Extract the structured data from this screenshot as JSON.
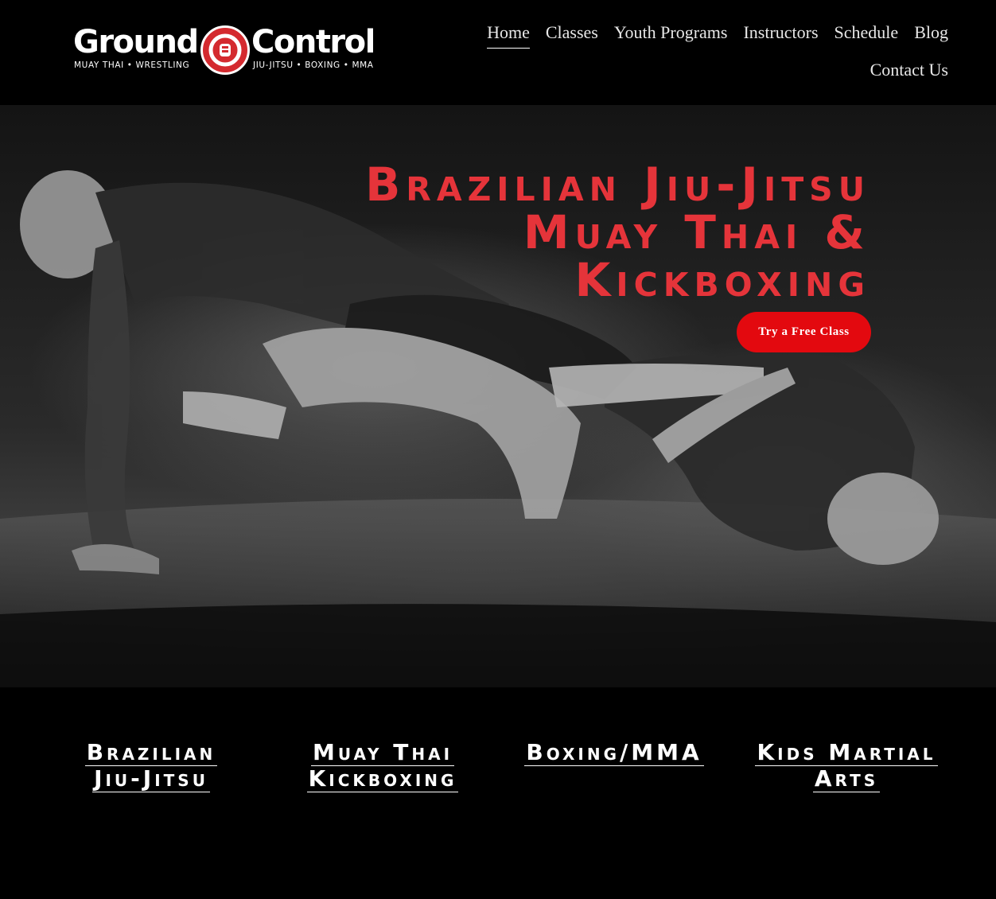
{
  "brand": {
    "name_left": "Ground",
    "name_right": "Control",
    "tagline_left": "MUAY THAI • WRESTLING",
    "tagline_right": "JIU-JITSU • BOXING • MMA",
    "emblem_icon": "fist-emblem-icon",
    "accent_color": "#e5343a"
  },
  "nav": {
    "items": [
      {
        "label": "Home",
        "active": true
      },
      {
        "label": "Classes"
      },
      {
        "label": "Youth Programs"
      },
      {
        "label": "Instructors"
      },
      {
        "label": "Schedule"
      },
      {
        "label": "Blog"
      },
      {
        "label": "Contact Us"
      }
    ]
  },
  "hero": {
    "title_lines": [
      "Brazilian Jiu-Jitsu",
      "Muay Thai &",
      "Kickboxing"
    ],
    "cta_label": "Try a Free Class",
    "cta_color": "#e3090f"
  },
  "programs": [
    {
      "lines": [
        "Brazilian",
        "Jiu-Jitsu"
      ]
    },
    {
      "lines": [
        "Muay Thai",
        "Kickboxing"
      ]
    },
    {
      "lines": [
        "Boxing/MMA"
      ]
    },
    {
      "lines": [
        "Kids Martial",
        "Arts"
      ]
    }
  ]
}
